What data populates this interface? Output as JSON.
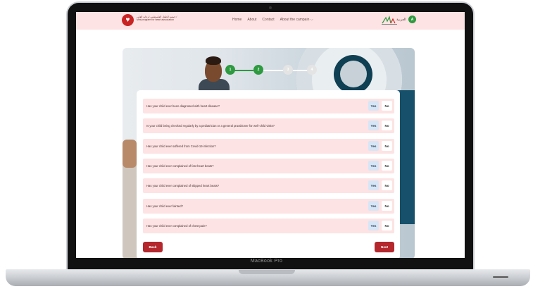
{
  "device": {
    "brand_label": "MacBook Pro"
  },
  "header": {
    "logo_text": "جمعية الطفل الفلسطيني لرعاية القلب / Mini program for heart association",
    "nav": [
      {
        "label": "Home"
      },
      {
        "label": "About"
      },
      {
        "label": "Contact"
      },
      {
        "label": "About the campain"
      }
    ],
    "language_toggle": "العربية",
    "avatar_initial": "A"
  },
  "stepper": {
    "steps": [
      {
        "label": "1",
        "state": "done"
      },
      {
        "label": "2",
        "state": "done"
      },
      {
        "label": "3",
        "state": "todo"
      },
      {
        "label": "4",
        "state": "todo"
      }
    ]
  },
  "questions": [
    {
      "text": "Has your child ever been diagnosed with heart disease?",
      "yes": "Yes",
      "no": "No"
    },
    {
      "text": "Is your child being checked regularly by a pediatrician or a general practitioner for well-child visits?",
      "yes": "Yes",
      "no": "No"
    },
    {
      "text": "Has your child ever suffered from Covid-19 infection?",
      "yes": "Yes",
      "no": "No"
    },
    {
      "text": "Has your child ever complained of fast heart beats?",
      "yes": "Yes",
      "no": "No"
    },
    {
      "text": "Has your child ever complained of skipped heart beats?",
      "yes": "Yes",
      "no": "No"
    },
    {
      "text": "Has your child ever fainted?",
      "yes": "Yes",
      "no": "No"
    },
    {
      "text": "Has your child ever complained of chest pain?",
      "yes": "Yes",
      "no": "No"
    }
  ],
  "actions": {
    "back": "Back",
    "next": "Next"
  },
  "colors": {
    "accent": "#b3272d",
    "header_bg": "#fde3e3",
    "step_done": "#2e9a40",
    "yes_bg": "#d7e6f6"
  }
}
